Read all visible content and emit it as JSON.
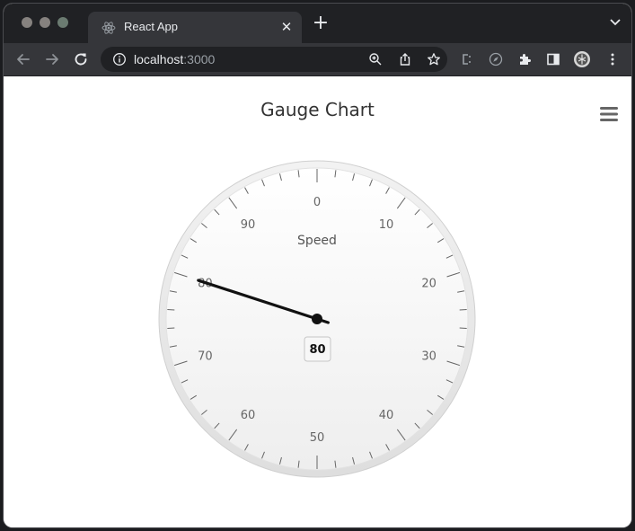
{
  "browser": {
    "tab_title": "React App",
    "url_host": "localhost",
    "url_port": ":3000"
  },
  "chart": {
    "title": "Gauge Chart",
    "pane_title": "Speed",
    "value_label": "80"
  },
  "chart_data": {
    "type": "gauge",
    "title": "Gauge Chart",
    "series": [
      {
        "name": "Speed",
        "values": [
          80
        ]
      }
    ],
    "value": 80,
    "range": [
      0,
      100
    ],
    "tick_labels": [
      "0",
      "10",
      "20",
      "30",
      "40",
      "50",
      "60",
      "70",
      "80",
      "90"
    ],
    "dial_color": "#111111",
    "face_gradient": [
      "#ffffff",
      "#eeeeee"
    ]
  }
}
